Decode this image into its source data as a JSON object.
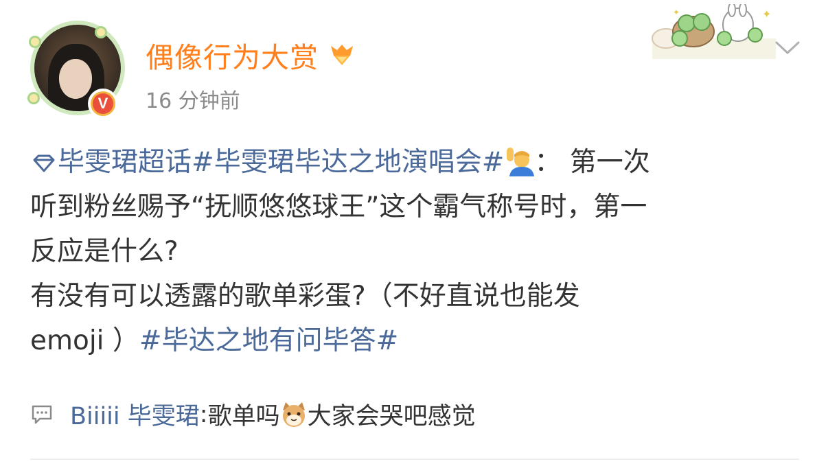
{
  "post": {
    "username": "偶像行为大赏",
    "timestamp": "16 分钟前",
    "lines": [
      {
        "tag": "毕雯珺超话",
        "tag2": "#毕雯珺毕达之地演唱会#",
        "after_emoji": "： 第一次"
      },
      {
        "text": "听到粉丝赐予“抚顺悠悠球王”这个霸气称号时，第一"
      },
      {
        "text": "反应是什么?"
      },
      {
        "text": "有没有可以透露的歌单彩蛋?（不好直说也能发"
      },
      {
        "text": " emoji ）",
        "tag": "#毕达之地有问毕答#"
      }
    ]
  },
  "comment": {
    "user": "Biiiii 毕雯珺",
    "colon": ": ",
    "text_before": "歌单吗",
    "text_after": "大家会哭吧感觉"
  },
  "icons": {
    "supertopic": "supertopic-diamond-icon",
    "verified": "verified-v-icon",
    "vip": "vip-badge-icon",
    "chevron": "chevron-down-icon",
    "comment": "comment-bubble-icon",
    "emoji_raise": "person-raising-hand-emoji",
    "emoji_cat": "cat-face-emoji"
  },
  "colors": {
    "username": "#ff7f1d",
    "tag": "#4b6a9a",
    "text": "#333333",
    "timestamp": "#8a8a8a"
  }
}
